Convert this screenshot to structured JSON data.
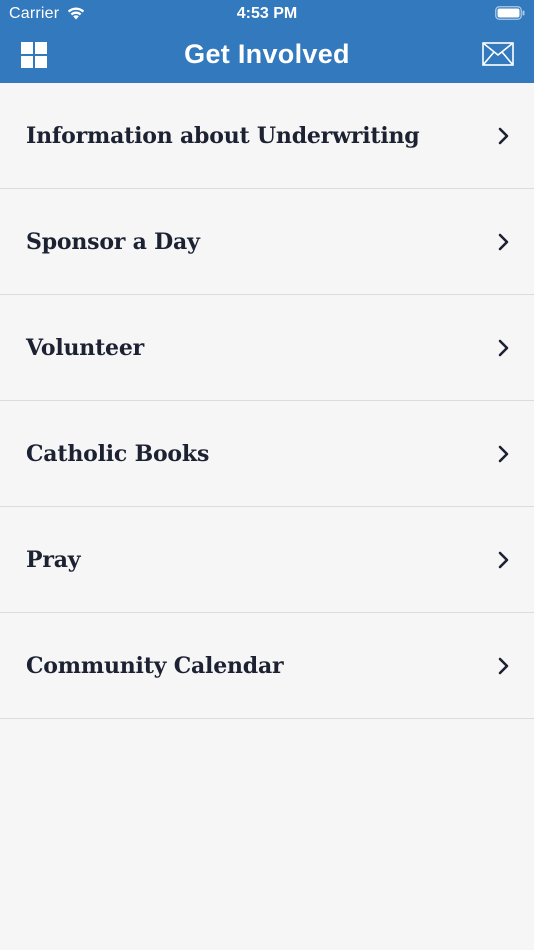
{
  "status_bar": {
    "carrier": "Carrier",
    "time": "4:53 PM",
    "wifi_icon": "wifi-icon",
    "battery_icon": "battery-full-icon"
  },
  "nav": {
    "title": "Get Involved",
    "left_icon": "grid-menu-icon",
    "right_icon": "mail-icon"
  },
  "items": [
    {
      "label": "Information about Underwriting"
    },
    {
      "label": "Sponsor a Day"
    },
    {
      "label": "Volunteer"
    },
    {
      "label": "Catholic Books"
    },
    {
      "label": "Pray"
    },
    {
      "label": "Community Calendar"
    }
  ],
  "colors": {
    "brand_blue": "#3379bd",
    "background": "#f6f6f6",
    "text_dark": "#1d2233",
    "divider": "#dcdcdc"
  }
}
